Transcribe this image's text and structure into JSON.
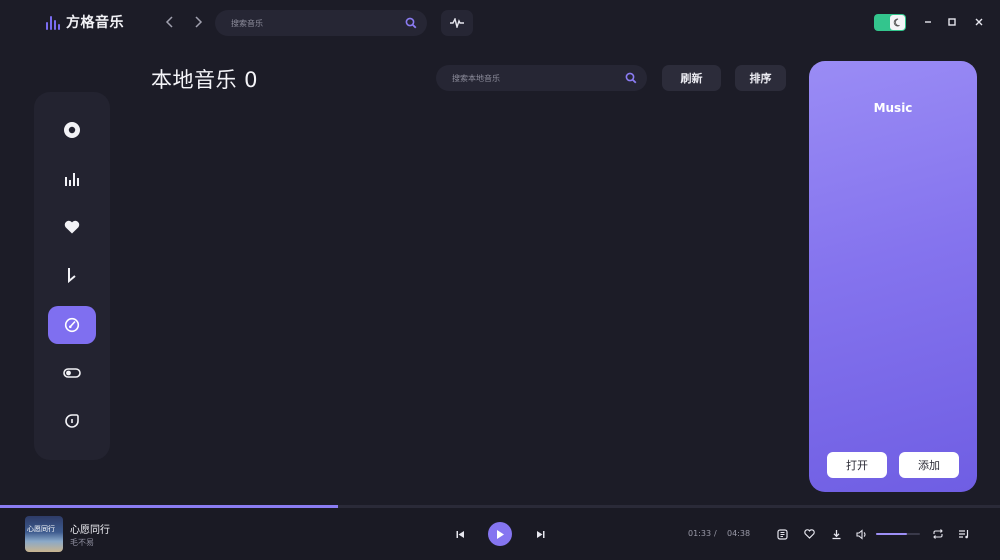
{
  "app": {
    "name": "方格音乐"
  },
  "titlebar": {
    "search_placeholder": "搜索音乐"
  },
  "sidebar": {
    "items": [
      {
        "icon": "disc-icon",
        "active": false
      },
      {
        "icon": "chart-icon",
        "active": false
      },
      {
        "icon": "heart-icon",
        "active": false
      },
      {
        "icon": "download-icon",
        "active": false
      },
      {
        "icon": "local-music-icon",
        "active": true
      },
      {
        "icon": "toggle-icon",
        "active": false
      },
      {
        "icon": "info-icon",
        "active": false
      }
    ]
  },
  "main": {
    "title": "本地音乐 0",
    "search_placeholder": "搜索本地音乐",
    "refresh_label": "刷新",
    "sort_label": "排序"
  },
  "panel": {
    "title": "Music",
    "open_label": "打开",
    "add_label": "添加"
  },
  "player": {
    "song_title": "心愿同行",
    "artist": "毛不易",
    "cover_text": "心愿同行",
    "current_time": "01:33",
    "separator": "/",
    "total_time": "04:38",
    "progress": 0.338,
    "volume": 0.7
  },
  "colors": {
    "accent": "#8575f0",
    "toggle_on": "#33c58d",
    "background": "#1c1c27"
  }
}
